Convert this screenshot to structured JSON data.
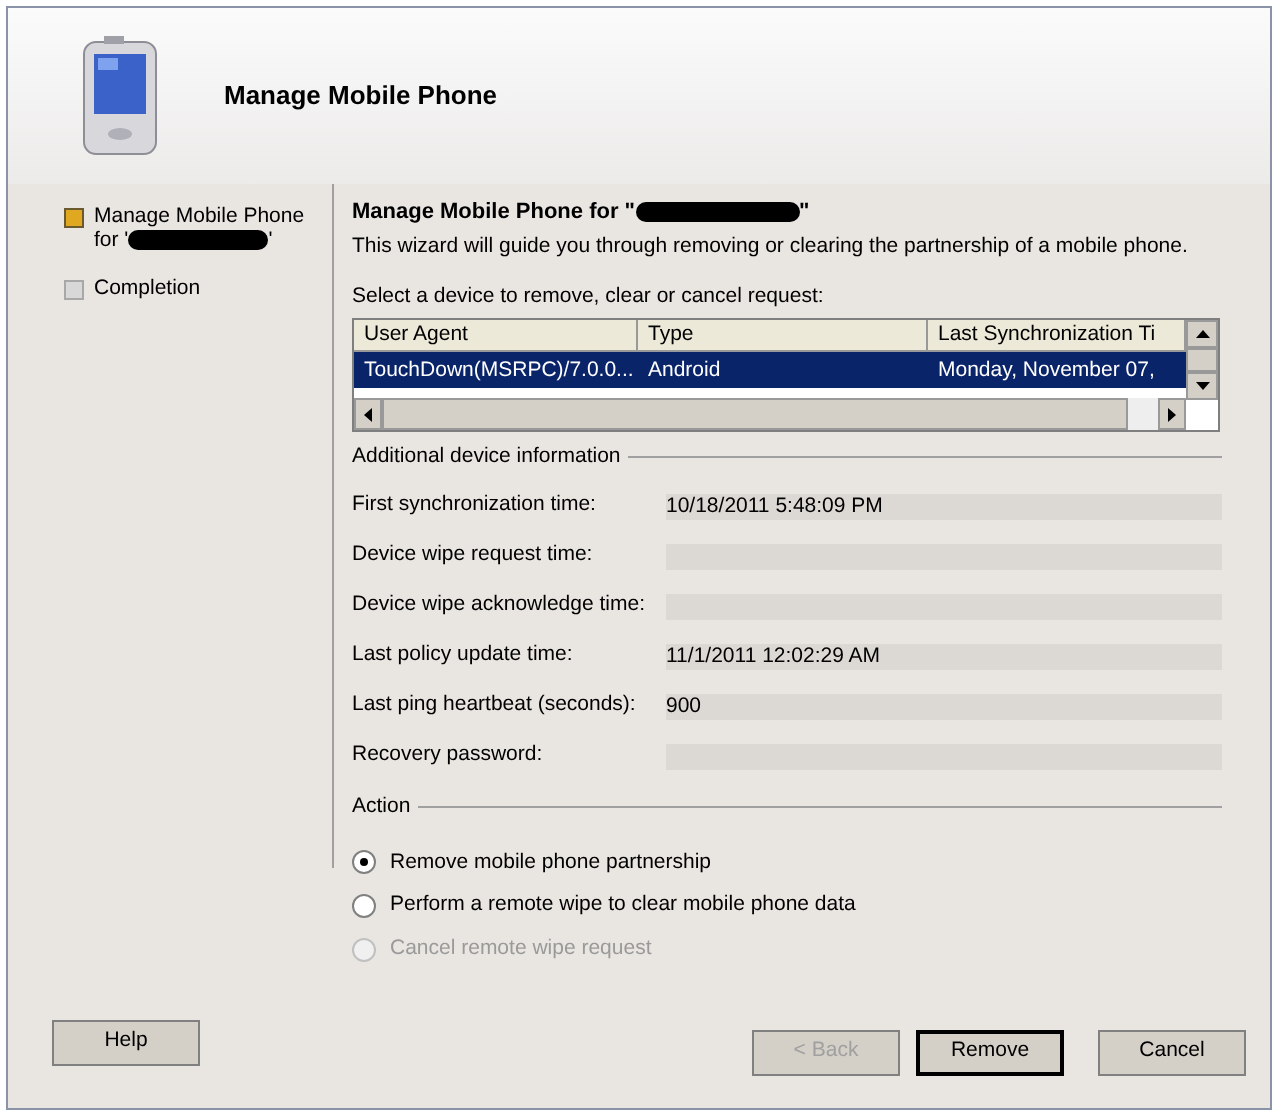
{
  "header": {
    "title": "Manage Mobile Phone"
  },
  "steps": [
    {
      "label": "Manage Mobile Phone",
      "label_line2": "for '",
      "suffix": "'",
      "redacted": true,
      "selected": true
    },
    {
      "label": "Completion",
      "selected": false,
      "redacted": false
    }
  ],
  "page": {
    "heading": "Manage Mobile Phone for \"",
    "heading_suffix": "\"",
    "heading_redacted": true,
    "intro": "This wizard will guide you through removing or clearing the partnership of a mobile phone.",
    "list_label": "Select a device to remove, clear or cancel request:"
  },
  "table": {
    "columns": [
      "User Agent",
      "Type",
      "Last Synchronization Ti"
    ],
    "rows": [
      {
        "cells": [
          "TouchDown(MSRPC)/7.0.0...",
          "Android",
          "Monday, November 07,"
        ],
        "selected": true
      }
    ]
  },
  "info": {
    "title": "Additional device information",
    "fields": [
      {
        "label": "First synchronization time:",
        "value": "10/18/2011 5:48:09 PM"
      },
      {
        "label": "Device wipe request time:"
      },
      {
        "label": "Device wipe acknowledge time:"
      },
      {
        "label": "Last policy update time:",
        "value": "11/1/2011 12:02:29 AM"
      },
      {
        "label": "Last ping heartbeat (seconds):",
        "value": "900"
      },
      {
        "label": "Recovery password:"
      }
    ]
  },
  "action": {
    "title": "Action",
    "options": [
      {
        "label": "Remove mobile phone partnership",
        "selected": true,
        "disabled": false
      },
      {
        "label": "Perform a remote wipe to clear mobile phone data",
        "selected": false,
        "disabled": false
      },
      {
        "label": "Cancel remote wipe request",
        "selected": false,
        "disabled": true
      }
    ]
  },
  "buttons": [
    {
      "label": "Help",
      "kind": "help",
      "disabled": false,
      "default": false
    },
    {
      "label": "< Back",
      "kind": "nav",
      "disabled": true,
      "default": false
    },
    {
      "label": "Remove",
      "kind": "nav",
      "disabled": false,
      "default": true
    },
    {
      "label": "Cancel",
      "kind": "nav",
      "disabled": false,
      "default": false
    }
  ]
}
